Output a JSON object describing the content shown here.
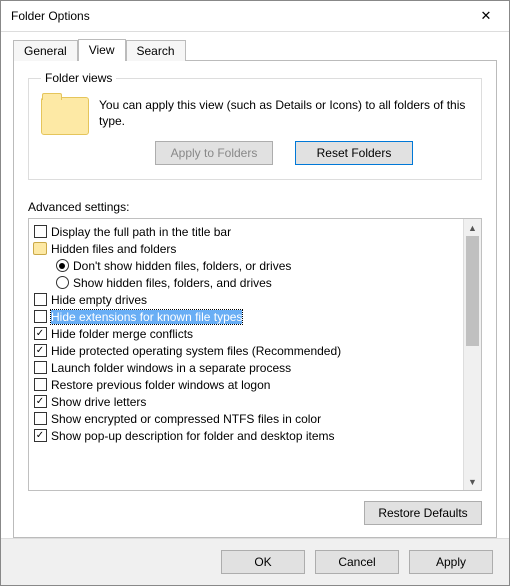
{
  "title": "Folder Options",
  "tabs": {
    "general": "General",
    "view": "View",
    "search": "Search"
  },
  "folder_views": {
    "legend": "Folder views",
    "desc": "You can apply this view (such as Details or Icons) to all folders of this type.",
    "apply_btn": "Apply to Folders",
    "reset_btn": "Reset Folders"
  },
  "advanced_label": "Advanced settings:",
  "items": [
    {
      "kind": "check",
      "checked": false,
      "label": "Display the full path in the title bar",
      "indent": 0
    },
    {
      "kind": "folder",
      "label": "Hidden files and folders",
      "indent": 0
    },
    {
      "kind": "radio",
      "checked": true,
      "label": "Don't show hidden files, folders, or drives",
      "indent": 1
    },
    {
      "kind": "radio",
      "checked": false,
      "label": "Show hidden files, folders, and drives",
      "indent": 1
    },
    {
      "kind": "check",
      "checked": false,
      "label": "Hide empty drives",
      "indent": 0
    },
    {
      "kind": "check",
      "checked": false,
      "label": "Hide extensions for known file types",
      "indent": 0,
      "selected": true
    },
    {
      "kind": "check",
      "checked": true,
      "label": "Hide folder merge conflicts",
      "indent": 0
    },
    {
      "kind": "check",
      "checked": true,
      "label": "Hide protected operating system files (Recommended)",
      "indent": 0
    },
    {
      "kind": "check",
      "checked": false,
      "label": "Launch folder windows in a separate process",
      "indent": 0
    },
    {
      "kind": "check",
      "checked": false,
      "label": "Restore previous folder windows at logon",
      "indent": 0
    },
    {
      "kind": "check",
      "checked": true,
      "label": "Show drive letters",
      "indent": 0
    },
    {
      "kind": "check",
      "checked": false,
      "label": "Show encrypted or compressed NTFS files in color",
      "indent": 0
    },
    {
      "kind": "check",
      "checked": true,
      "label": "Show pop-up description for folder and desktop items",
      "indent": 0
    }
  ],
  "restore_defaults": "Restore Defaults",
  "footer": {
    "ok": "OK",
    "cancel": "Cancel",
    "apply": "Apply"
  }
}
